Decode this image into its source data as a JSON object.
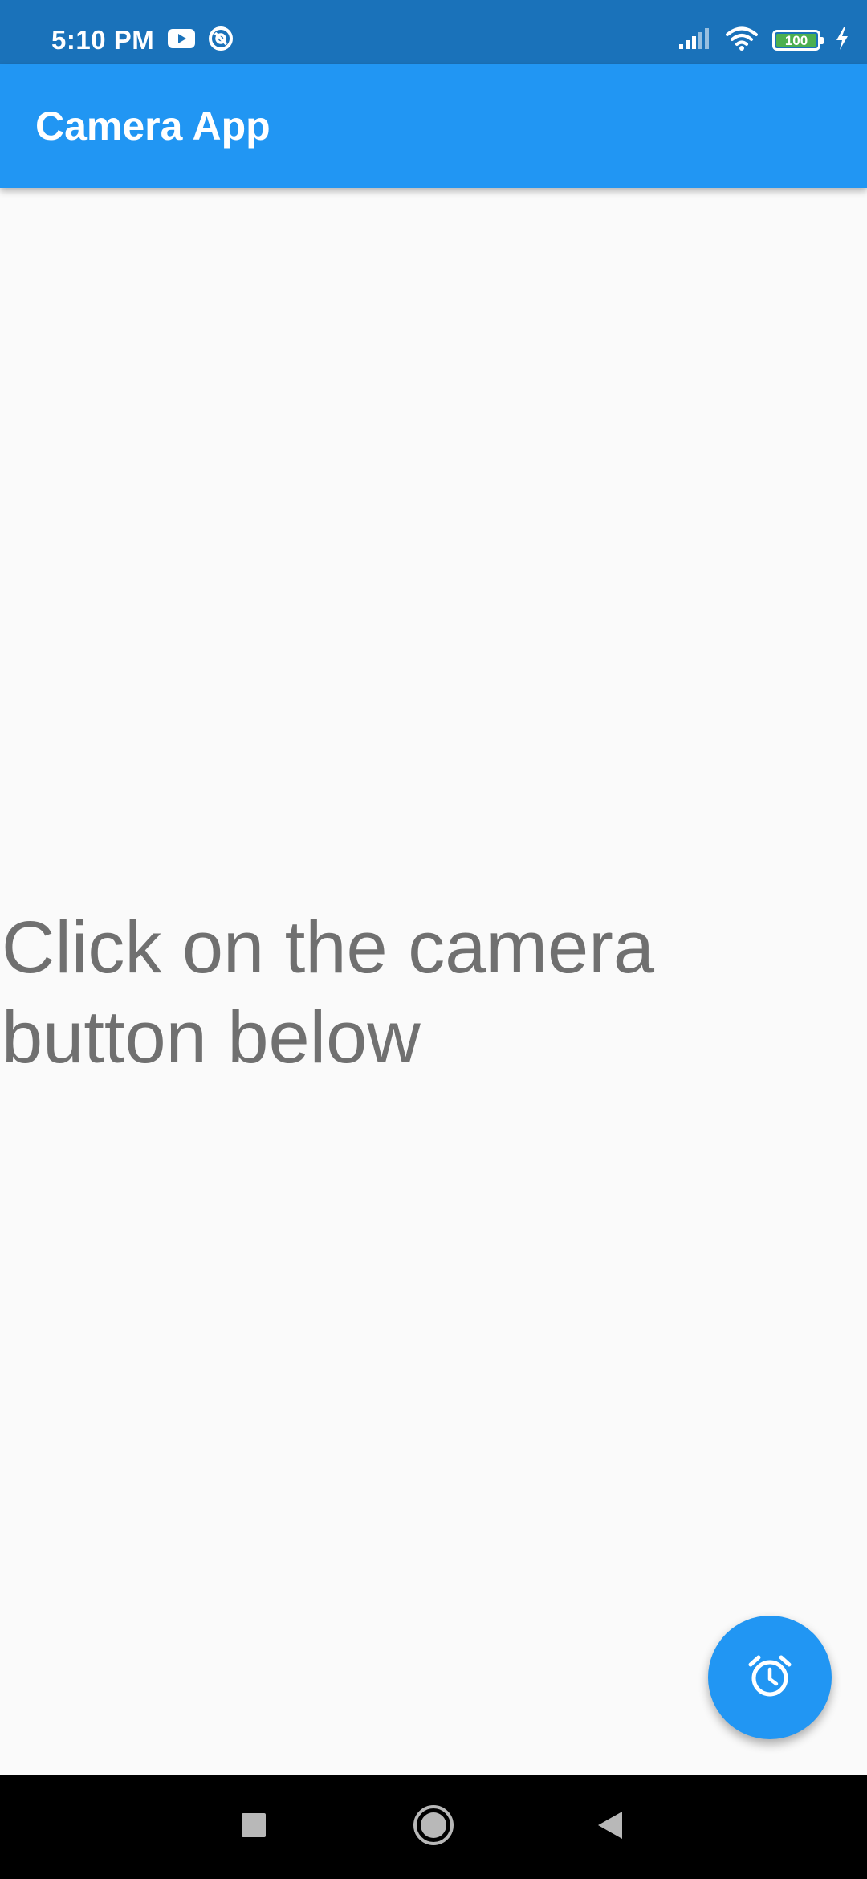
{
  "status_bar": {
    "time": "5:10 PM",
    "battery_level": "100",
    "icons_left": [
      "youtube-icon",
      "sync-icon"
    ],
    "icons_right": [
      "signal-icon",
      "wifi-icon",
      "battery-icon",
      "charging-icon"
    ]
  },
  "app_bar": {
    "title": "Camera App"
  },
  "body": {
    "instruction": "Click on the camera button below"
  },
  "fab": {
    "icon": "alarm-icon"
  },
  "nav_bar": {
    "buttons": [
      "recents-button",
      "home-button",
      "back-button"
    ]
  },
  "colors": {
    "status_bar": "#1a72ba",
    "app_bar": "#2196f3",
    "fab": "#2196f3",
    "body_background": "#fafafa",
    "body_text": "#707070",
    "nav_bar": "#000000",
    "battery_fill": "#4caf50"
  }
}
